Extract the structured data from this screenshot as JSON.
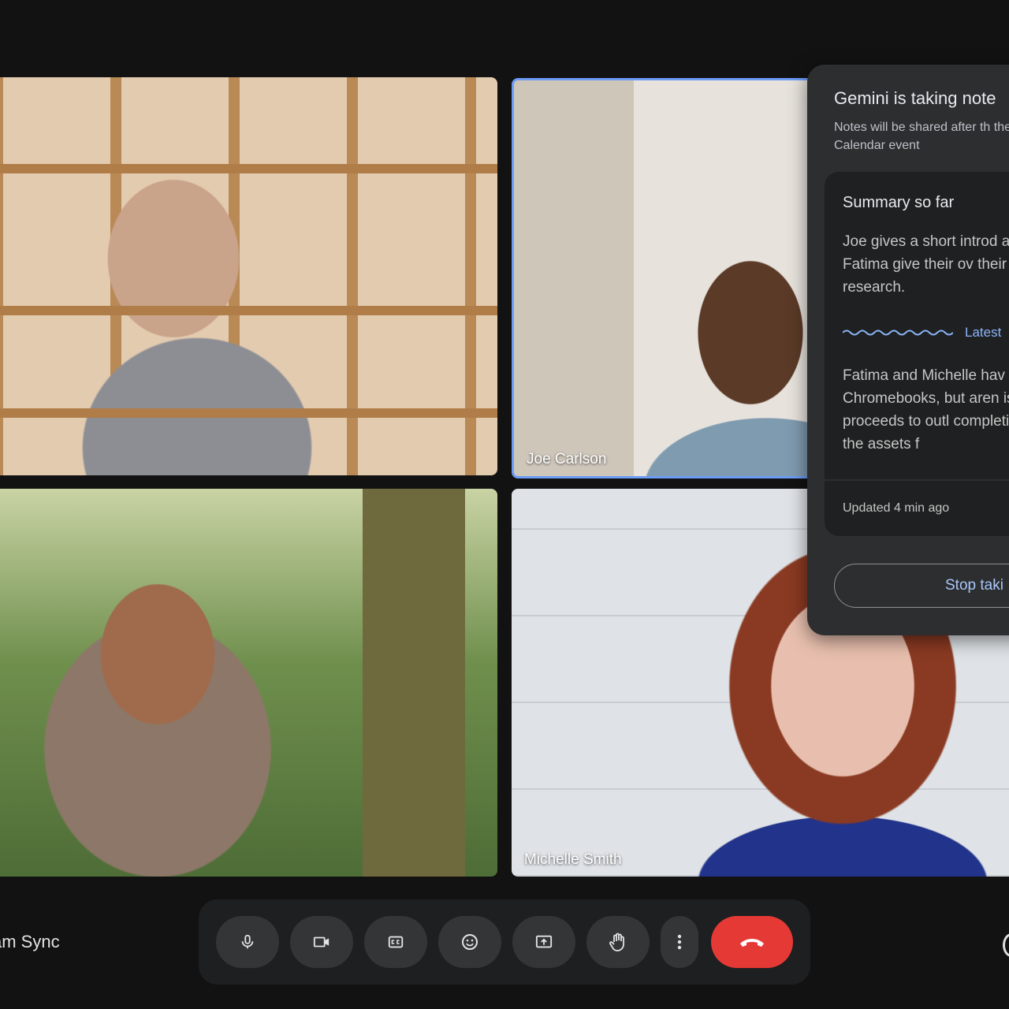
{
  "participants": [
    {
      "name": ""
    },
    {
      "name": "Joe Carlson"
    },
    {
      "name": ""
    },
    {
      "name": "Michelle Smith"
    }
  ],
  "gemini_panel": {
    "title": "Gemini is taking note",
    "subtitle": "Notes will be shared after th the Calendar event",
    "summary": {
      "heading": "Summary so far",
      "text_1": "Joe gives a short introd and Fatima give their ov their research.",
      "latest_label": "Latest",
      "text_2": "Fatima and Michelle hav Chromebooks, but aren is. Joe proceeds to outl completing the assets f",
      "updated": "Updated 4 min ago"
    },
    "stop_button_label": "Stop taki"
  },
  "meeting": {
    "title": "am Sync"
  },
  "controls": [
    {
      "name": "microphone-icon"
    },
    {
      "name": "camera-icon"
    },
    {
      "name": "captions-icon"
    },
    {
      "name": "emoji-icon"
    },
    {
      "name": "present-screen-icon"
    },
    {
      "name": "raise-hand-icon"
    },
    {
      "name": "more-options-icon"
    },
    {
      "name": "end-call-icon"
    }
  ],
  "colors": {
    "accent": "#8ab4f8",
    "active_speaker_border": "#6b9cf6",
    "hangup": "#e53935"
  }
}
